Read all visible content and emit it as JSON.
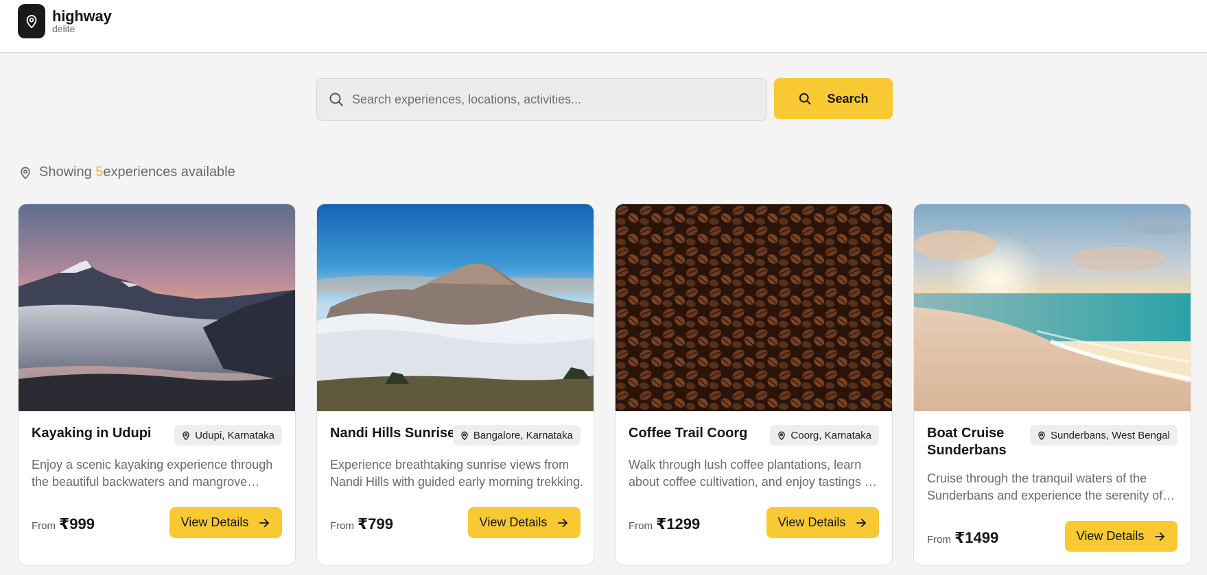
{
  "brand": {
    "title": "highway",
    "subtitle": "delite"
  },
  "search": {
    "placeholder": "Search experiences, locations, activities...",
    "value": "",
    "button_label": "Search"
  },
  "results": {
    "prefix": "Showing ",
    "count": "5",
    "suffix": "experiences available"
  },
  "colors": {
    "accent": "#f8c932",
    "count": "#f3b612",
    "brand_dark": "#1a1a1a"
  },
  "cards": [
    {
      "title": "Kayaking in Udupi",
      "location": "Udupi, Karnataka",
      "description": "Enjoy a scenic kayaking experience through the beautiful backwaters and mangrove forests.",
      "from_label": "From",
      "price": "₹999",
      "button_label": "View Details"
    },
    {
      "title": "Nandi Hills Sunrise",
      "location": "Bangalore, Karnataka",
      "description": "Experience breathtaking sunrise views from Nandi Hills with guided early morning trekking.",
      "from_label": "From",
      "price": "₹799",
      "button_label": "View Details"
    },
    {
      "title": "Coffee Trail Coorg",
      "location": "Coorg, Karnataka",
      "description": "Walk through lush coffee plantations, learn about coffee cultivation, and enjoy tastings of fresh brews.",
      "from_label": "From",
      "price": "₹1299",
      "button_label": "View Details"
    },
    {
      "title": "Boat Cruise Sunderbans",
      "location": "Sunderbans, West Bengal",
      "description": "Cruise through the tranquil waters of the Sunderbans and experience the serenity of the mangroves.",
      "from_label": "From",
      "price": "₹1499",
      "button_label": "View Details"
    }
  ]
}
